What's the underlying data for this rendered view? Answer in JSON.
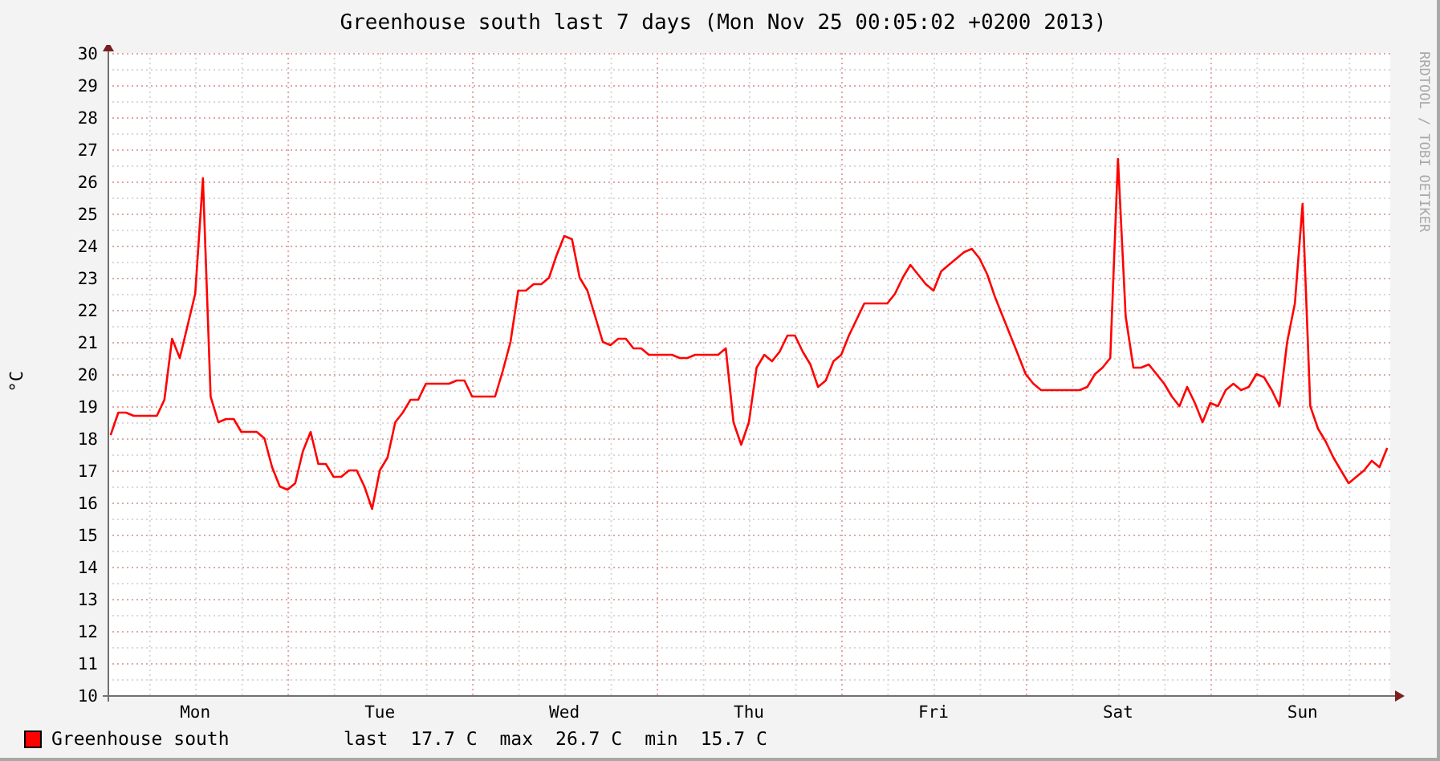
{
  "title": "Greenhouse south last 7 days (Mon Nov 25 00:05:02 +0200 2013)",
  "unit_label": "°C",
  "credit": "RRDTOOL / TOBI OETIKER",
  "chart_data": {
    "type": "line",
    "grid": true,
    "ylim": [
      10,
      30
    ],
    "yticks": [
      10,
      11,
      12,
      13,
      14,
      15,
      16,
      17,
      18,
      19,
      20,
      21,
      22,
      23,
      24,
      25,
      26,
      27,
      28,
      29,
      30
    ],
    "categories": [
      null,
      null,
      null,
      null,
      null,
      null,
      null,
      null,
      null,
      null,
      null,
      "Mon",
      null,
      null,
      null,
      null,
      null,
      null,
      null,
      null,
      null,
      null,
      null,
      null,
      null,
      null,
      null,
      null,
      null,
      null,
      null,
      null,
      null,
      null,
      null,
      "Tue",
      null,
      null,
      null,
      null,
      null,
      null,
      null,
      null,
      null,
      null,
      null,
      null,
      null,
      null,
      null,
      null,
      null,
      null,
      null,
      null,
      null,
      null,
      null,
      "Wed",
      null,
      null,
      null,
      null,
      null,
      null,
      null,
      null,
      null,
      null,
      null,
      null,
      null,
      null,
      null,
      null,
      null,
      null,
      null,
      null,
      null,
      null,
      null,
      "Thu",
      null,
      null,
      null,
      null,
      null,
      null,
      null,
      null,
      null,
      null,
      null,
      null,
      null,
      null,
      null,
      null,
      null,
      null,
      null,
      null,
      null,
      null,
      null,
      "Fri",
      null,
      null,
      null,
      null,
      null,
      null,
      null,
      null,
      null,
      null,
      null,
      null,
      null,
      null,
      null,
      null,
      null,
      null,
      null,
      null,
      null,
      null,
      null,
      "Sat",
      null,
      null,
      null,
      null,
      null,
      null,
      null,
      null,
      null,
      null,
      null,
      null,
      null,
      null,
      null,
      null,
      null,
      null,
      null,
      null,
      null,
      null,
      null,
      "Sun",
      null,
      null,
      null,
      null,
      null,
      null,
      null,
      null,
      null,
      null,
      null
    ],
    "series": [
      {
        "name": "Greenhouse south",
        "color": "#ff0000",
        "values": [
          18.1,
          18.8,
          18.8,
          18.7,
          18.7,
          18.7,
          18.7,
          19.2,
          21.1,
          20.5,
          21.5,
          22.5,
          26.1,
          19.3,
          18.5,
          18.6,
          18.6,
          18.2,
          18.2,
          18.2,
          18.0,
          17.1,
          16.5,
          16.4,
          16.6,
          17.6,
          18.2,
          17.2,
          17.2,
          16.8,
          16.8,
          17.0,
          17.0,
          16.5,
          15.8,
          17.0,
          17.4,
          18.5,
          18.8,
          19.2,
          19.2,
          19.7,
          19.7,
          19.7,
          19.7,
          19.8,
          19.8,
          19.3,
          19.3,
          19.3,
          19.3,
          20.1,
          21.0,
          22.6,
          22.6,
          22.8,
          22.8,
          23.0,
          23.7,
          24.3,
          24.2,
          23.0,
          22.6,
          21.8,
          21.0,
          20.9,
          21.1,
          21.1,
          20.8,
          20.8,
          20.6,
          20.6,
          20.6,
          20.6,
          20.5,
          20.5,
          20.6,
          20.6,
          20.6,
          20.6,
          20.8,
          18.5,
          17.8,
          18.5,
          20.2,
          20.6,
          20.4,
          20.7,
          21.2,
          21.2,
          20.7,
          20.3,
          19.6,
          19.8,
          20.4,
          20.6,
          21.2,
          21.7,
          22.2,
          22.2,
          22.2,
          22.2,
          22.5,
          23.0,
          23.4,
          23.1,
          22.8,
          22.6,
          23.2,
          23.4,
          23.6,
          23.8,
          23.9,
          23.6,
          23.1,
          22.4,
          21.8,
          21.2,
          20.6,
          20.0,
          19.7,
          19.5,
          19.5,
          19.5,
          19.5,
          19.5,
          19.5,
          19.6,
          20.0,
          20.2,
          20.5,
          26.7,
          21.8,
          20.2,
          20.2,
          20.3,
          20.0,
          19.7,
          19.3,
          19.0,
          19.6,
          19.1,
          18.5,
          19.1,
          19.0,
          19.5,
          19.7,
          19.5,
          19.6,
          20.0,
          19.9,
          19.5,
          19.0,
          21.0,
          22.2,
          25.3,
          19.0,
          18.3,
          17.9,
          17.4,
          17.0,
          16.6,
          16.8,
          17.0,
          17.3,
          17.1,
          17.7
        ]
      }
    ]
  },
  "legend": {
    "stats": [
      {
        "label": "last",
        "value": "17.7 C"
      },
      {
        "label": "max",
        "value": "26.7 C"
      },
      {
        "label": "min",
        "value": "15.7 C"
      }
    ]
  }
}
